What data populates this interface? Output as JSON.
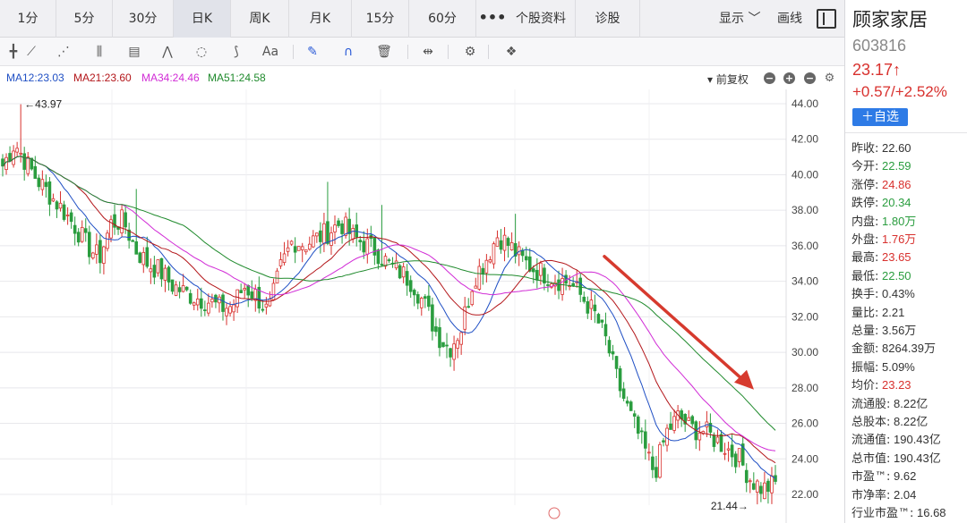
{
  "tabs": [
    {
      "label": "1分",
      "active": false
    },
    {
      "label": "5分",
      "active": false
    },
    {
      "label": "30分",
      "active": false
    },
    {
      "label": "日K",
      "active": true
    },
    {
      "label": "周K",
      "active": false
    },
    {
      "label": "月K",
      "active": false
    },
    {
      "label": "15分",
      "active": false
    },
    {
      "label": "60分",
      "active": false
    }
  ],
  "more_label": "•••",
  "extra_tabs": [
    "个股资料",
    "诊股"
  ],
  "display_menu": "显示 ﹀",
  "draw_label": "画线",
  "toolbar_icons": [
    "cross-line",
    "fan-lines",
    "parallel-channel",
    "bar-lines",
    "rectangle-text",
    "wave-lines",
    "cycle",
    "fibonacci",
    "text-aa",
    "pen",
    "magnet",
    "delete",
    "measure",
    "settings",
    "layers"
  ],
  "ma_legend": [
    {
      "label": "MA12:23.03",
      "color": "#1f4fc4"
    },
    {
      "label": "MA21:23.60",
      "color": "#b3161a"
    },
    {
      "label": "MA34:24.46",
      "color": "#d12cd6"
    },
    {
      "label": "MA51:24.58",
      "color": "#1f8a2c"
    }
  ],
  "fq_label": "▾ 前复权",
  "stock": {
    "name": "顾家家居",
    "code": "603816",
    "price": "23.17↑",
    "change": "+0.57/+2.52%",
    "add_label": "＋自选"
  },
  "stats": [
    {
      "key": "昨收:",
      "value": "22.60",
      "color": "flat"
    },
    {
      "key": "今开:",
      "value": "22.59",
      "color": "down"
    },
    {
      "key": "涨停:",
      "value": "24.86",
      "color": "up"
    },
    {
      "key": "跌停:",
      "value": "20.34",
      "color": "down"
    },
    {
      "key": "内盘:",
      "value": "1.80万",
      "color": "down"
    },
    {
      "key": "外盘:",
      "value": "1.76万",
      "color": "up"
    },
    {
      "key": "最高:",
      "value": "23.65",
      "color": "up"
    },
    {
      "key": "最低:",
      "value": "22.50",
      "color": "down"
    },
    {
      "key": "换手:",
      "value": "0.43%",
      "color": "flat"
    },
    {
      "key": "量比:",
      "value": "2.21",
      "color": "flat"
    },
    {
      "key": "总量:",
      "value": "3.56万",
      "color": "flat"
    },
    {
      "key": "金额:",
      "value": "8264.39万",
      "color": "flat"
    },
    {
      "key": "振幅:",
      "value": "5.09%",
      "color": "flat"
    },
    {
      "key": "均价:",
      "value": "23.23",
      "color": "up"
    },
    {
      "key": "流通股:",
      "value": "8.22亿",
      "color": "flat"
    },
    {
      "key": "总股本:",
      "value": "8.22亿",
      "color": "flat"
    },
    {
      "key": "流通值:",
      "value": "190.43亿",
      "color": "flat"
    },
    {
      "key": "总市值:",
      "value": "190.43亿",
      "color": "flat"
    },
    {
      "key": "市盈™:",
      "value": "9.62",
      "color": "flat"
    },
    {
      "key": "市净率:",
      "value": "2.04",
      "color": "flat"
    },
    {
      "key": "行业市盈™:",
      "value": "16.68",
      "color": "flat"
    }
  ],
  "colors": {
    "up": "#d8312e",
    "down": "#2a9d3f",
    "arrow": "#d63a2e",
    "grid": "#e8e8ec"
  },
  "chart_data": {
    "type": "candlestick",
    "y_ticks": [
      "44.00",
      "42.00",
      "40.00",
      "38.00",
      "36.00",
      "34.00",
      "32.00",
      "30.00",
      "28.00",
      "26.00",
      "24.00",
      "22.00"
    ],
    "ylim": [
      20.8,
      45.0
    ],
    "high_marker": {
      "label": "←43.97",
      "value": 43.97
    },
    "low_marker": {
      "label": "21.44→",
      "value": 21.44
    },
    "trend_arrow": {
      "from": 35.4,
      "to": 27.9,
      "direction": "down"
    },
    "close_anchors": [
      40.5,
      41.8,
      40.6,
      39.6,
      38.8,
      38.0,
      37.1,
      36.0,
      35.3,
      37.3,
      37.4,
      35.8,
      35.0,
      34.6,
      33.8,
      33.4,
      33.1,
      32.9,
      32.5,
      32.6,
      33.7,
      33.2,
      32.2,
      34.7,
      36.3,
      36.1,
      36.4,
      36.8,
      37.3,
      36.5,
      36.1,
      35.7,
      34.9,
      34.5,
      33.9,
      32.6,
      31.0,
      30.2,
      31.4,
      34.2,
      35.2,
      36.6,
      36.0,
      35.2,
      34.7,
      34.4,
      34.1,
      33.9,
      33.1,
      32.2,
      30.6,
      28.2,
      26.4,
      24.8,
      23.2,
      25.5,
      26.4,
      25.7,
      25.6,
      25.1,
      24.6,
      24.0,
      22.8,
      22.3,
      22.6
    ]
  }
}
